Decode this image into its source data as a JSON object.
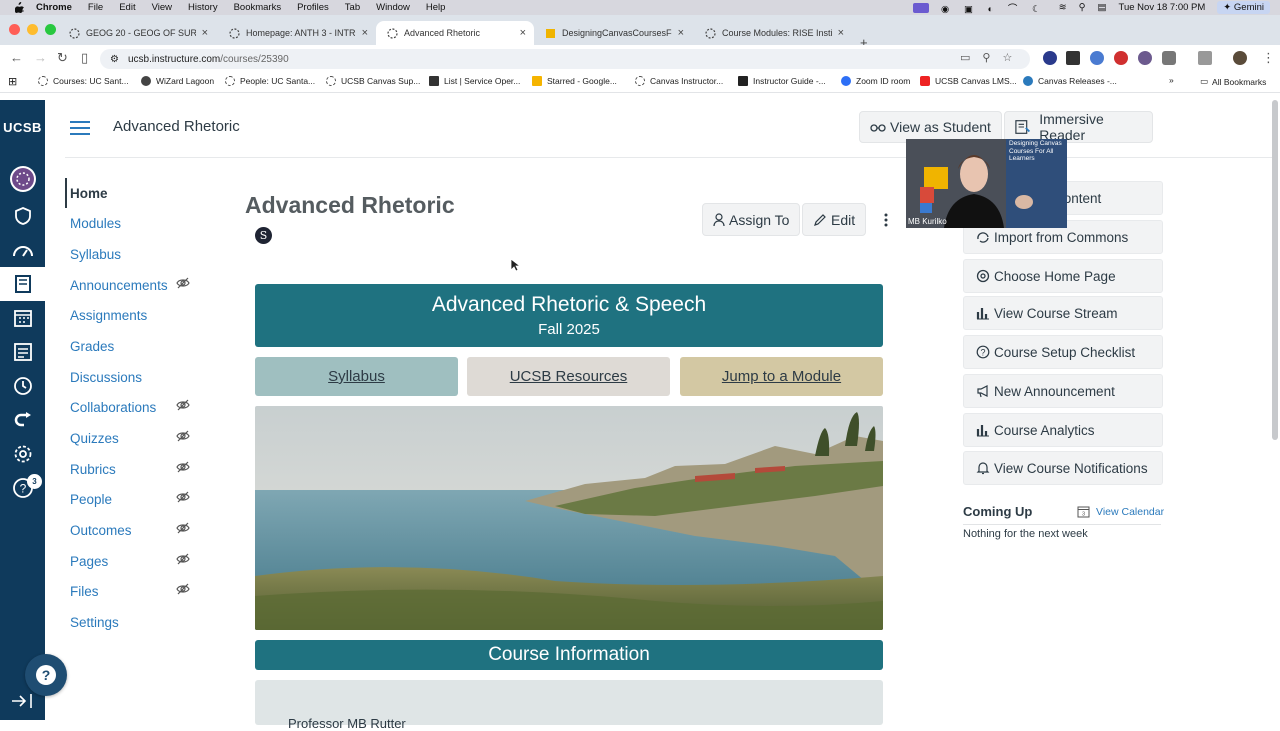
{
  "mac": {
    "menu": [
      "Chrome",
      "File",
      "Edit",
      "View",
      "History",
      "Bookmarks",
      "Profiles",
      "Tab",
      "Window",
      "Help"
    ],
    "datetime": "Tue Nov 18  7:00 PM",
    "gemini": "Gemini"
  },
  "tabs": [
    {
      "label": "GEOG 20 - GEOG OF SURFING"
    },
    {
      "label": "Homepage: ANTH 3 - INTRO"
    },
    {
      "label": "Advanced Rhetoric"
    },
    {
      "label": "DesigningCanvasCoursesFor"
    },
    {
      "label": "Course Modules: RISE Institu"
    }
  ],
  "address": {
    "host": "ucsb.instructure.com",
    "path": "/courses/25390"
  },
  "bookmarks": [
    "Courses: UC Sant...",
    "WiZard Lagoon",
    "People: UC Santa...",
    "UCSB Canvas Sup...",
    "List | Service Oper...",
    "Starred - Google...",
    "Canvas Instructor...",
    "Instructor Guide -...",
    "Zoom ID room",
    "UCSB Canvas LMS...",
    "Canvas Releases -...",
    "All Bookmarks"
  ],
  "global_nav": {
    "logo": "UCSB",
    "help_badge": "3"
  },
  "header": {
    "breadcrumb": "Advanced Rhetoric",
    "view_as_student": "View as Student",
    "immersive_reader": "Immersive Reader"
  },
  "course_nav": [
    {
      "label": "Home"
    },
    {
      "label": "Modules"
    },
    {
      "label": "Syllabus"
    },
    {
      "label": "Announcements"
    },
    {
      "label": "Assignments"
    },
    {
      "label": "Grades"
    },
    {
      "label": "Discussions"
    },
    {
      "label": "Collaborations"
    },
    {
      "label": "Quizzes"
    },
    {
      "label": "Rubrics"
    },
    {
      "label": "People"
    },
    {
      "label": "Outcomes"
    },
    {
      "label": "Pages"
    },
    {
      "label": "Files"
    },
    {
      "label": "Settings"
    }
  ],
  "page": {
    "title": "Advanced Rhetoric",
    "badge": "S",
    "assign_to": "Assign To",
    "edit": "Edit",
    "banner_title": "Advanced Rhetoric & Speech",
    "banner_term": "Fall 2025",
    "quick_links": [
      {
        "label": "Syllabus",
        "color": "#9fbfc0"
      },
      {
        "label": "UCSB Resources",
        "color": "#dedad5"
      },
      {
        "label": "Jump to a Module",
        "color": "#d3c8a3"
      }
    ],
    "info_title": "Course Information",
    "info_partial": "Professor MB Rutter"
  },
  "sidebar": {
    "buttons": [
      "Importing Content",
      "Import from Commons",
      "Choose Home Page",
      "View Course Stream",
      "Course Setup Checklist",
      "New Announcement",
      "Course Analytics",
      "View Course Notifications"
    ],
    "coming_up": "Coming Up",
    "view_calendar": "View Calendar",
    "nothing": "Nothing for the next week"
  },
  "video": {
    "name": "MB Kurilko",
    "caption": "Designing Canvas Courses For All Learners"
  },
  "colors": {
    "canvas_nav": "#0f3a5c",
    "teal": "#1f7280",
    "link": "#2b7abc"
  }
}
